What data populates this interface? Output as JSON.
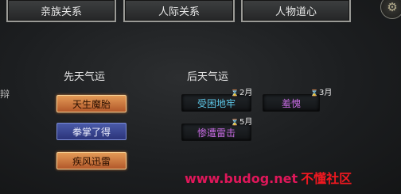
{
  "tabs": [
    {
      "label": "亲族关系"
    },
    {
      "label": "人际关系"
    },
    {
      "label": "人物道心"
    }
  ],
  "corner_icon": "gear-icon",
  "edge_char": "辩",
  "pre_section": {
    "title": "先天气运",
    "items": [
      {
        "label": "天生魔胎",
        "style": "gold"
      },
      {
        "label": "拳掌了得",
        "style": "blue"
      },
      {
        "label": "疾风迅雷",
        "style": "gold"
      }
    ]
  },
  "post_section": {
    "title": "后天气运",
    "items": [
      {
        "label": "受困地牢",
        "month": "2月",
        "color": "#5cc6e6"
      },
      {
        "label": "羞愧",
        "month": "3月",
        "color": "#c56ae0"
      },
      {
        "label": "惨遭雷击",
        "month": "5月",
        "color": "#c56ae0"
      }
    ]
  },
  "watermark": {
    "url": "www.budog.net",
    "site": "不懂社区",
    "url_color": "#e0175a",
    "site_color": "#f01820"
  }
}
